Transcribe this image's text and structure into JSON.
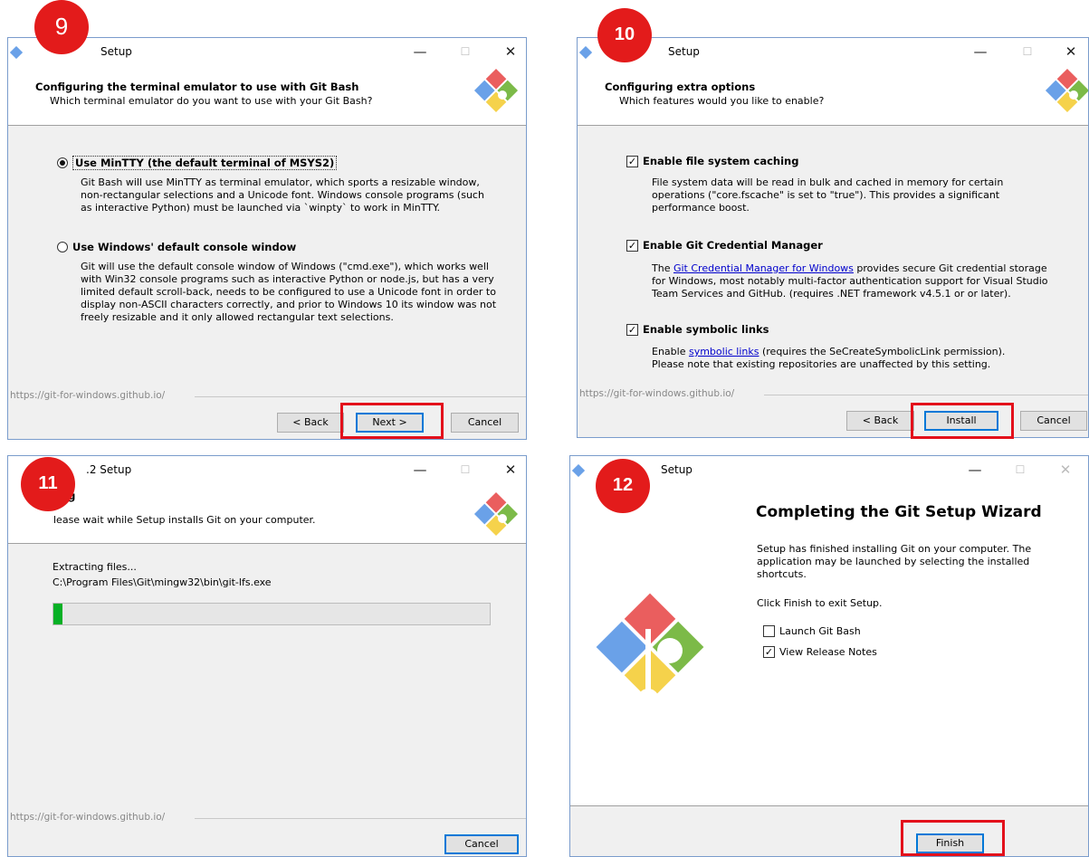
{
  "colors": {
    "badge": "#e31b1b",
    "highlight": "#e3101b",
    "progress": "#06b025",
    "link": "#0000cc"
  },
  "step9": {
    "badge": "9",
    "title": "Setup",
    "header_title": "Configuring the terminal emulator to use with Git Bash",
    "header_sub": "Which terminal emulator do you want to use with your Git Bash?",
    "opt1_label": "Use MinTTY (the default terminal of MSYS2)",
    "opt1_desc": "Git Bash will use MinTTY as terminal emulator, which sports a resizable window, non-rectangular selections and a Unicode font. Windows console programs (such as interactive Python) must be launched via `winpty` to work in MinTTY.",
    "opt2_label": "Use Windows' default console window",
    "opt2_desc": "Git will use the default console window of Windows (\"cmd.exe\"), which works well with Win32 console programs such as interactive Python or node.js, but has a very limited default scroll-back, needs to be configured to use a Unicode font in order to display non-ASCII characters correctly, and prior to Windows 10 its window was not freely resizable and it only allowed rectangular text selections.",
    "url": "https://git-for-windows.github.io/",
    "back": "< Back",
    "next": "Next >",
    "cancel": "Cancel",
    "selected_option": "Use MinTTY (the default terminal of MSYS2)"
  },
  "step10": {
    "badge": "10",
    "title": "Setup",
    "header_title": "Configuring extra options",
    "header_sub": "Which features would you like to enable?",
    "opt1_label": "Enable file system caching",
    "opt1_desc": "File system data will be read in bulk and cached in memory for certain operations (\"core.fscache\" is set to \"true\"). This provides a significant performance boost.",
    "opt2_label": "Enable Git Credential Manager",
    "opt2_desc_pre": "The ",
    "opt2_link": "Git Credential Manager for Windows",
    "opt2_desc_post": " provides secure Git credential storage for Windows, most notably multi-factor authentication support for Visual Studio Team Services and GitHub. (requires .NET framework v4.5.1 or or later).",
    "opt3_label": "Enable symbolic links",
    "opt3_desc_pre": "Enable ",
    "opt3_link": "symbolic links",
    "opt3_desc_post": " (requires the SeCreateSymbolicLink permission). Please note that existing repositories are unaffected by this setting.",
    "url": "https://git-for-windows.github.io/",
    "back": "< Back",
    "install": "Install",
    "cancel": "Cancel",
    "check_mark": "✓"
  },
  "step11": {
    "badge": "11",
    "title": ".2 Setup",
    "header_title": "ng",
    "header_sub": "lease wait while Setup installs Git on your computer.",
    "status": "Extracting files...",
    "path": "C:\\Program Files\\Git\\mingw32\\bin\\git-lfs.exe",
    "progress": 0.02,
    "url": "https://git-for-windows.github.io/",
    "cancel": "Cancel"
  },
  "step12": {
    "badge": "12",
    "title": "Setup",
    "heading": "Completing the Git Setup Wizard",
    "desc": "Setup has finished installing Git on your computer. The application may be launched by selecting the installed shortcuts.",
    "finish_hint": "Click Finish to exit Setup.",
    "cb1_label": "Launch Git Bash",
    "cb2_label": "View Release Notes",
    "check_mark": "✓",
    "finish": "Finish"
  }
}
